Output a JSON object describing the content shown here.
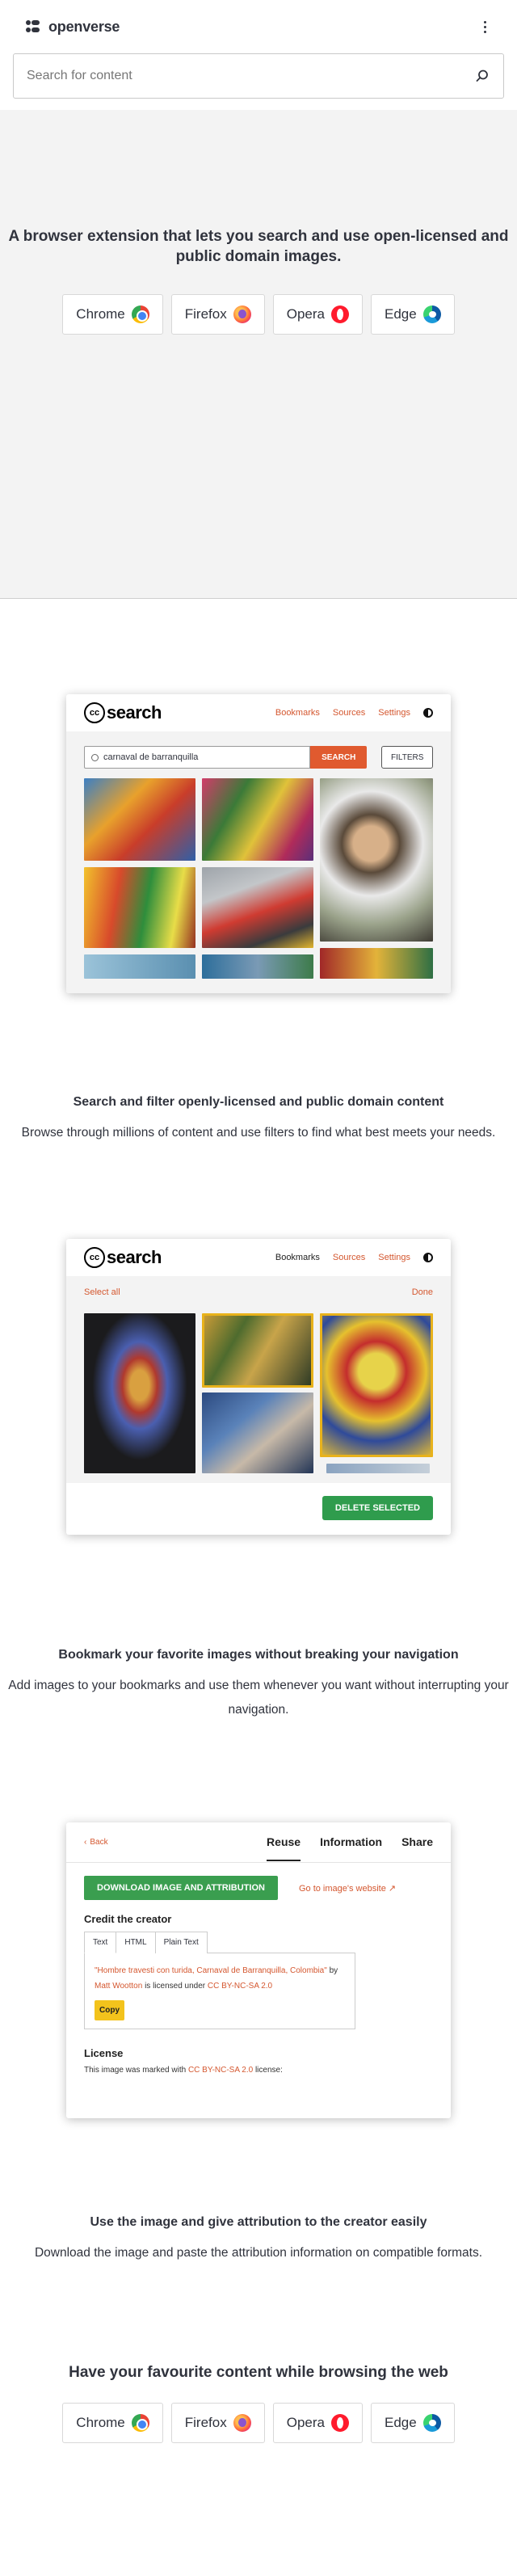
{
  "header": {
    "logo_text": "openverse",
    "menu_icon": "kebab-menu-icon"
  },
  "search": {
    "placeholder": "Search for content",
    "button_icon": "search-icon"
  },
  "hero": {
    "title": "A browser extension that lets you search and use open-licensed and public domain images.",
    "browsers": [
      {
        "label": "Chrome",
        "icon": "chrome-icon"
      },
      {
        "label": "Firefox",
        "icon": "firefox-icon"
      },
      {
        "label": "Opera",
        "icon": "opera-icon"
      },
      {
        "label": "Edge",
        "icon": "edge-icon"
      }
    ]
  },
  "feature_search": {
    "mock": {
      "logo": "search",
      "nav": [
        "Bookmarks",
        "Sources",
        "Settings"
      ],
      "query": "carnaval de barranquilla",
      "search_button": "SEARCH",
      "filters_button": "FILTERS"
    },
    "title": "Search and filter openly-licensed and public domain content",
    "text": "Browse through millions of content and use filters to find what best meets your needs."
  },
  "feature_bookmark": {
    "mock": {
      "logo": "search",
      "nav": [
        "Bookmarks",
        "Sources",
        "Settings"
      ],
      "select_all": "Select all",
      "done": "Done",
      "delete_button": "DELETE SELECTED"
    },
    "title": "Bookmark your favorite images without breaking your navigation",
    "text": "Add images to your bookmarks and use them whenever you want without interrupting your navigation."
  },
  "feature_reuse": {
    "mock": {
      "back": "Back",
      "tabs": [
        "Reuse",
        "Information",
        "Share"
      ],
      "download_button": "DOWNLOAD IMAGE AND ATTRIBUTION",
      "goto_link": "Go to image's website",
      "credit_title": "Credit the creator",
      "credit_tabs": [
        "Text",
        "HTML",
        "Plain Text"
      ],
      "attribution_title": "\"Hombre travesti con turida, Carnaval de Barranquilla, Colombia\"",
      "attribution_by": "by",
      "attribution_author": "Matt Wootton",
      "attribution_licensed": "is licensed under",
      "attribution_license": "CC BY-NC-SA 2.0",
      "copy_button": "Copy",
      "license_title": "License",
      "license_text_pre": "This image was marked with",
      "license_name": "CC BY-NC-SA 2.0",
      "license_text_post": "license:"
    },
    "title": "Use the image and give attribution to the creator easily",
    "text": "Download the image and paste the attribution information on compatible formats."
  },
  "footer": {
    "title": "Have your favourite content while browsing the web",
    "browsers": [
      {
        "label": "Chrome",
        "icon": "chrome-icon"
      },
      {
        "label": "Firefox",
        "icon": "firefox-icon"
      },
      {
        "label": "Opera",
        "icon": "opera-icon"
      },
      {
        "label": "Edge",
        "icon": "edge-icon"
      }
    ]
  },
  "colors": {
    "accent_orange": "#d4572f",
    "button_green": "#2f9c4d",
    "copy_yellow": "#f3c31c",
    "hero_bg": "#f3f3f3"
  }
}
